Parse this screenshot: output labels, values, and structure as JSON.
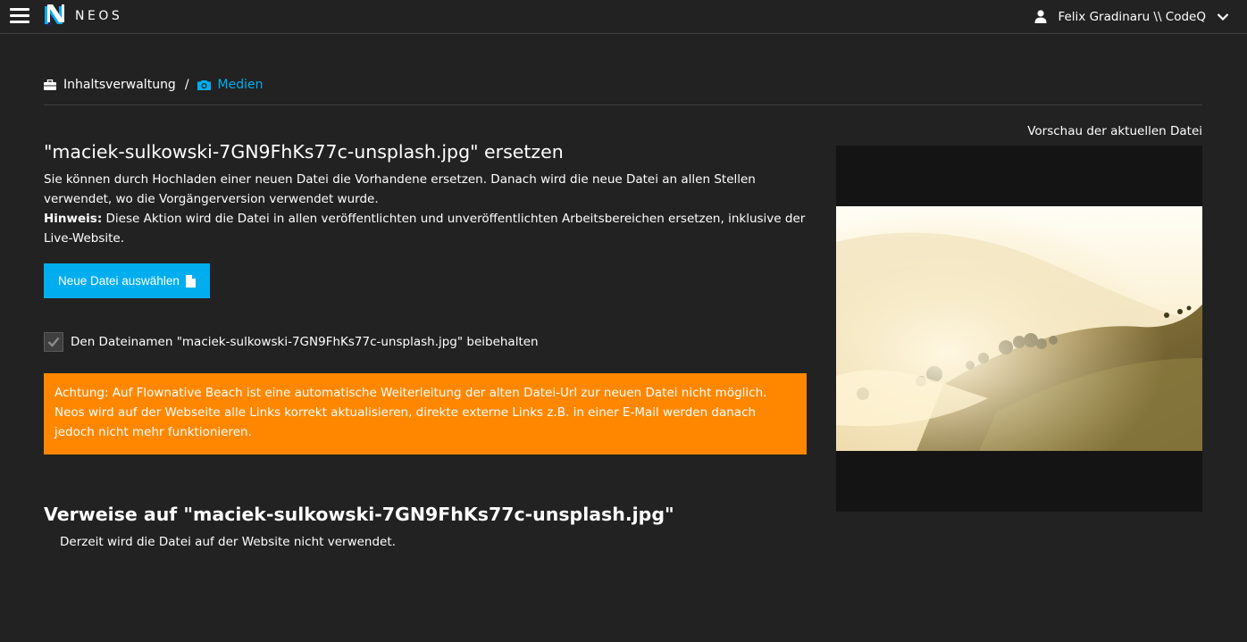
{
  "topbar": {
    "logo_text": "NEOS",
    "user_name": "Felix Gradinaru \\\\ CodeQ"
  },
  "breadcrumb": {
    "items": [
      {
        "label": "Inhaltsverwaltung",
        "icon": "briefcase-icon"
      },
      {
        "label": "Medien",
        "icon": "camera-icon"
      }
    ],
    "separator": "/"
  },
  "replace": {
    "title": "\"maciek-sulkowski-7GN9FhKs77c-unsplash.jpg\" ersetzen",
    "description": "Sie können durch Hochladen einer neuen Datei die Vorhandene ersetzen. Danach wird die neue Datei an allen Stellen verwendet, wo die Vorgängerversion verwendet wurde.",
    "note_label": "Hinweis:",
    "note_text": " Diese Aktion wird die Datei in allen veröffentlichten und unveröffentlichten Arbeitsbereichen ersetzen, inklusive der Live-Website.",
    "button_label": "Neue Datei auswählen",
    "keep_filename_label": "Den Dateinamen \"maciek-sulkowski-7GN9FhKs77c-unsplash.jpg\" beibehalten",
    "keep_filename_checked": true,
    "warning": "Achtung: Auf Flownative Beach ist eine automatische Weiterleitung der alten Datei-Url zur neuen Datei nicht möglich. Neos wird auf der Webseite alle Links korrekt aktualisieren, direkte externe Links z.B. in einer E-Mail werden danach jedoch nicht mehr funktionieren."
  },
  "references": {
    "title": "Verweise auf \"maciek-sulkowski-7GN9FhKs77c-unsplash.jpg\"",
    "text": "Derzeit wird die Datei auf der Website nicht verwendet."
  },
  "preview": {
    "label": "Vorschau der aktuellen Datei"
  },
  "colors": {
    "background": "#222222",
    "accent": "#00adee",
    "warning": "#ff8700"
  }
}
